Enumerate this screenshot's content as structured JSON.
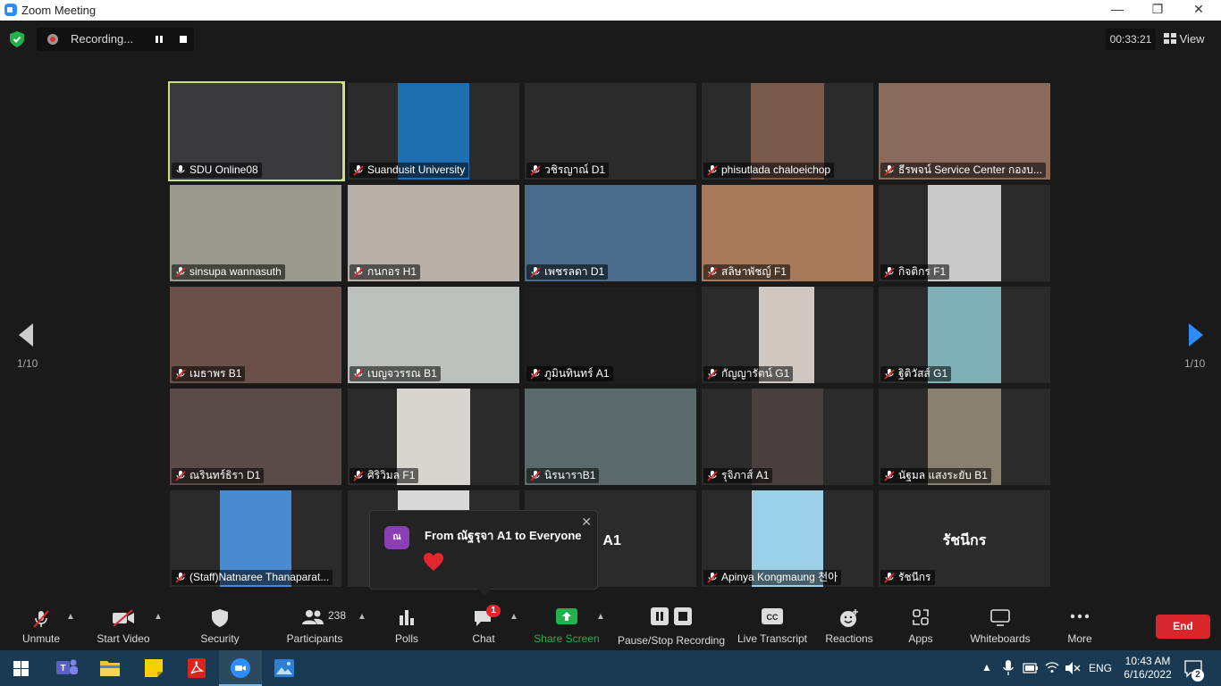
{
  "window": {
    "title": "Zoom Meeting"
  },
  "recording": {
    "label": "Recording..."
  },
  "timer": "00:33:21",
  "view_label": "View",
  "pagination": {
    "left": "1/10",
    "right": "1/10"
  },
  "participants": [
    "SDU Online08",
    "Suandusit University",
    "วชิรญาณ์ D1",
    "phisutlada chaloeichop",
    "ธีรพจน์ Service Center กองบ...",
    "sinsupa wannasuth",
    "กนกอร H1",
    "เพชรลดา D1",
    "สลิษาพัชญ์ F1",
    "กิจติกร  F1",
    "เมธาพร B1",
    "เบญจวรรณ B1",
    "ภูมินทินทร์ A1",
    "กัญญารัตน์ G1",
    "ฐิติวัสส์ G1",
    "ณรินทร์ธิรา D1",
    "ศิริวิมล F1",
    "นิรนาราB1",
    "รุจิภาส์  A1",
    "นัฐมล แสงระยับ B1",
    "(Staff)Natnaree Thanaparat...",
    "",
    "",
    "Apinya Kongmaung 천아",
    "รัชนีกร"
  ],
  "center_names": {
    "tile23": "รุจา A1",
    "tile25": "รัชนีกร"
  },
  "chat_popup": {
    "avatar": "ณ",
    "from": "From ณัฐรุจา A1 to Everyone"
  },
  "toolbar": {
    "unmute": "Unmute",
    "start_video": "Start Video",
    "security": "Security",
    "participants": "Participants",
    "participants_count": "238",
    "polls": "Polls",
    "chat": "Chat",
    "chat_badge": "1",
    "share_screen": "Share Screen",
    "pause_stop_recording": "Pause/Stop Recording",
    "live_transcript": "Live Transcript",
    "reactions": "Reactions",
    "apps": "Apps",
    "whiteboards": "Whiteboards",
    "more": "More",
    "end": "End"
  },
  "tray": {
    "lang": "ENG",
    "time": "10:43 AM",
    "date": "6/16/2022",
    "notif_count": "2"
  },
  "colors": {
    "accent": "#2d8cff",
    "share_green": "#22b14c",
    "end_red": "#d9262b",
    "active_speaker": "#c9e37a"
  }
}
